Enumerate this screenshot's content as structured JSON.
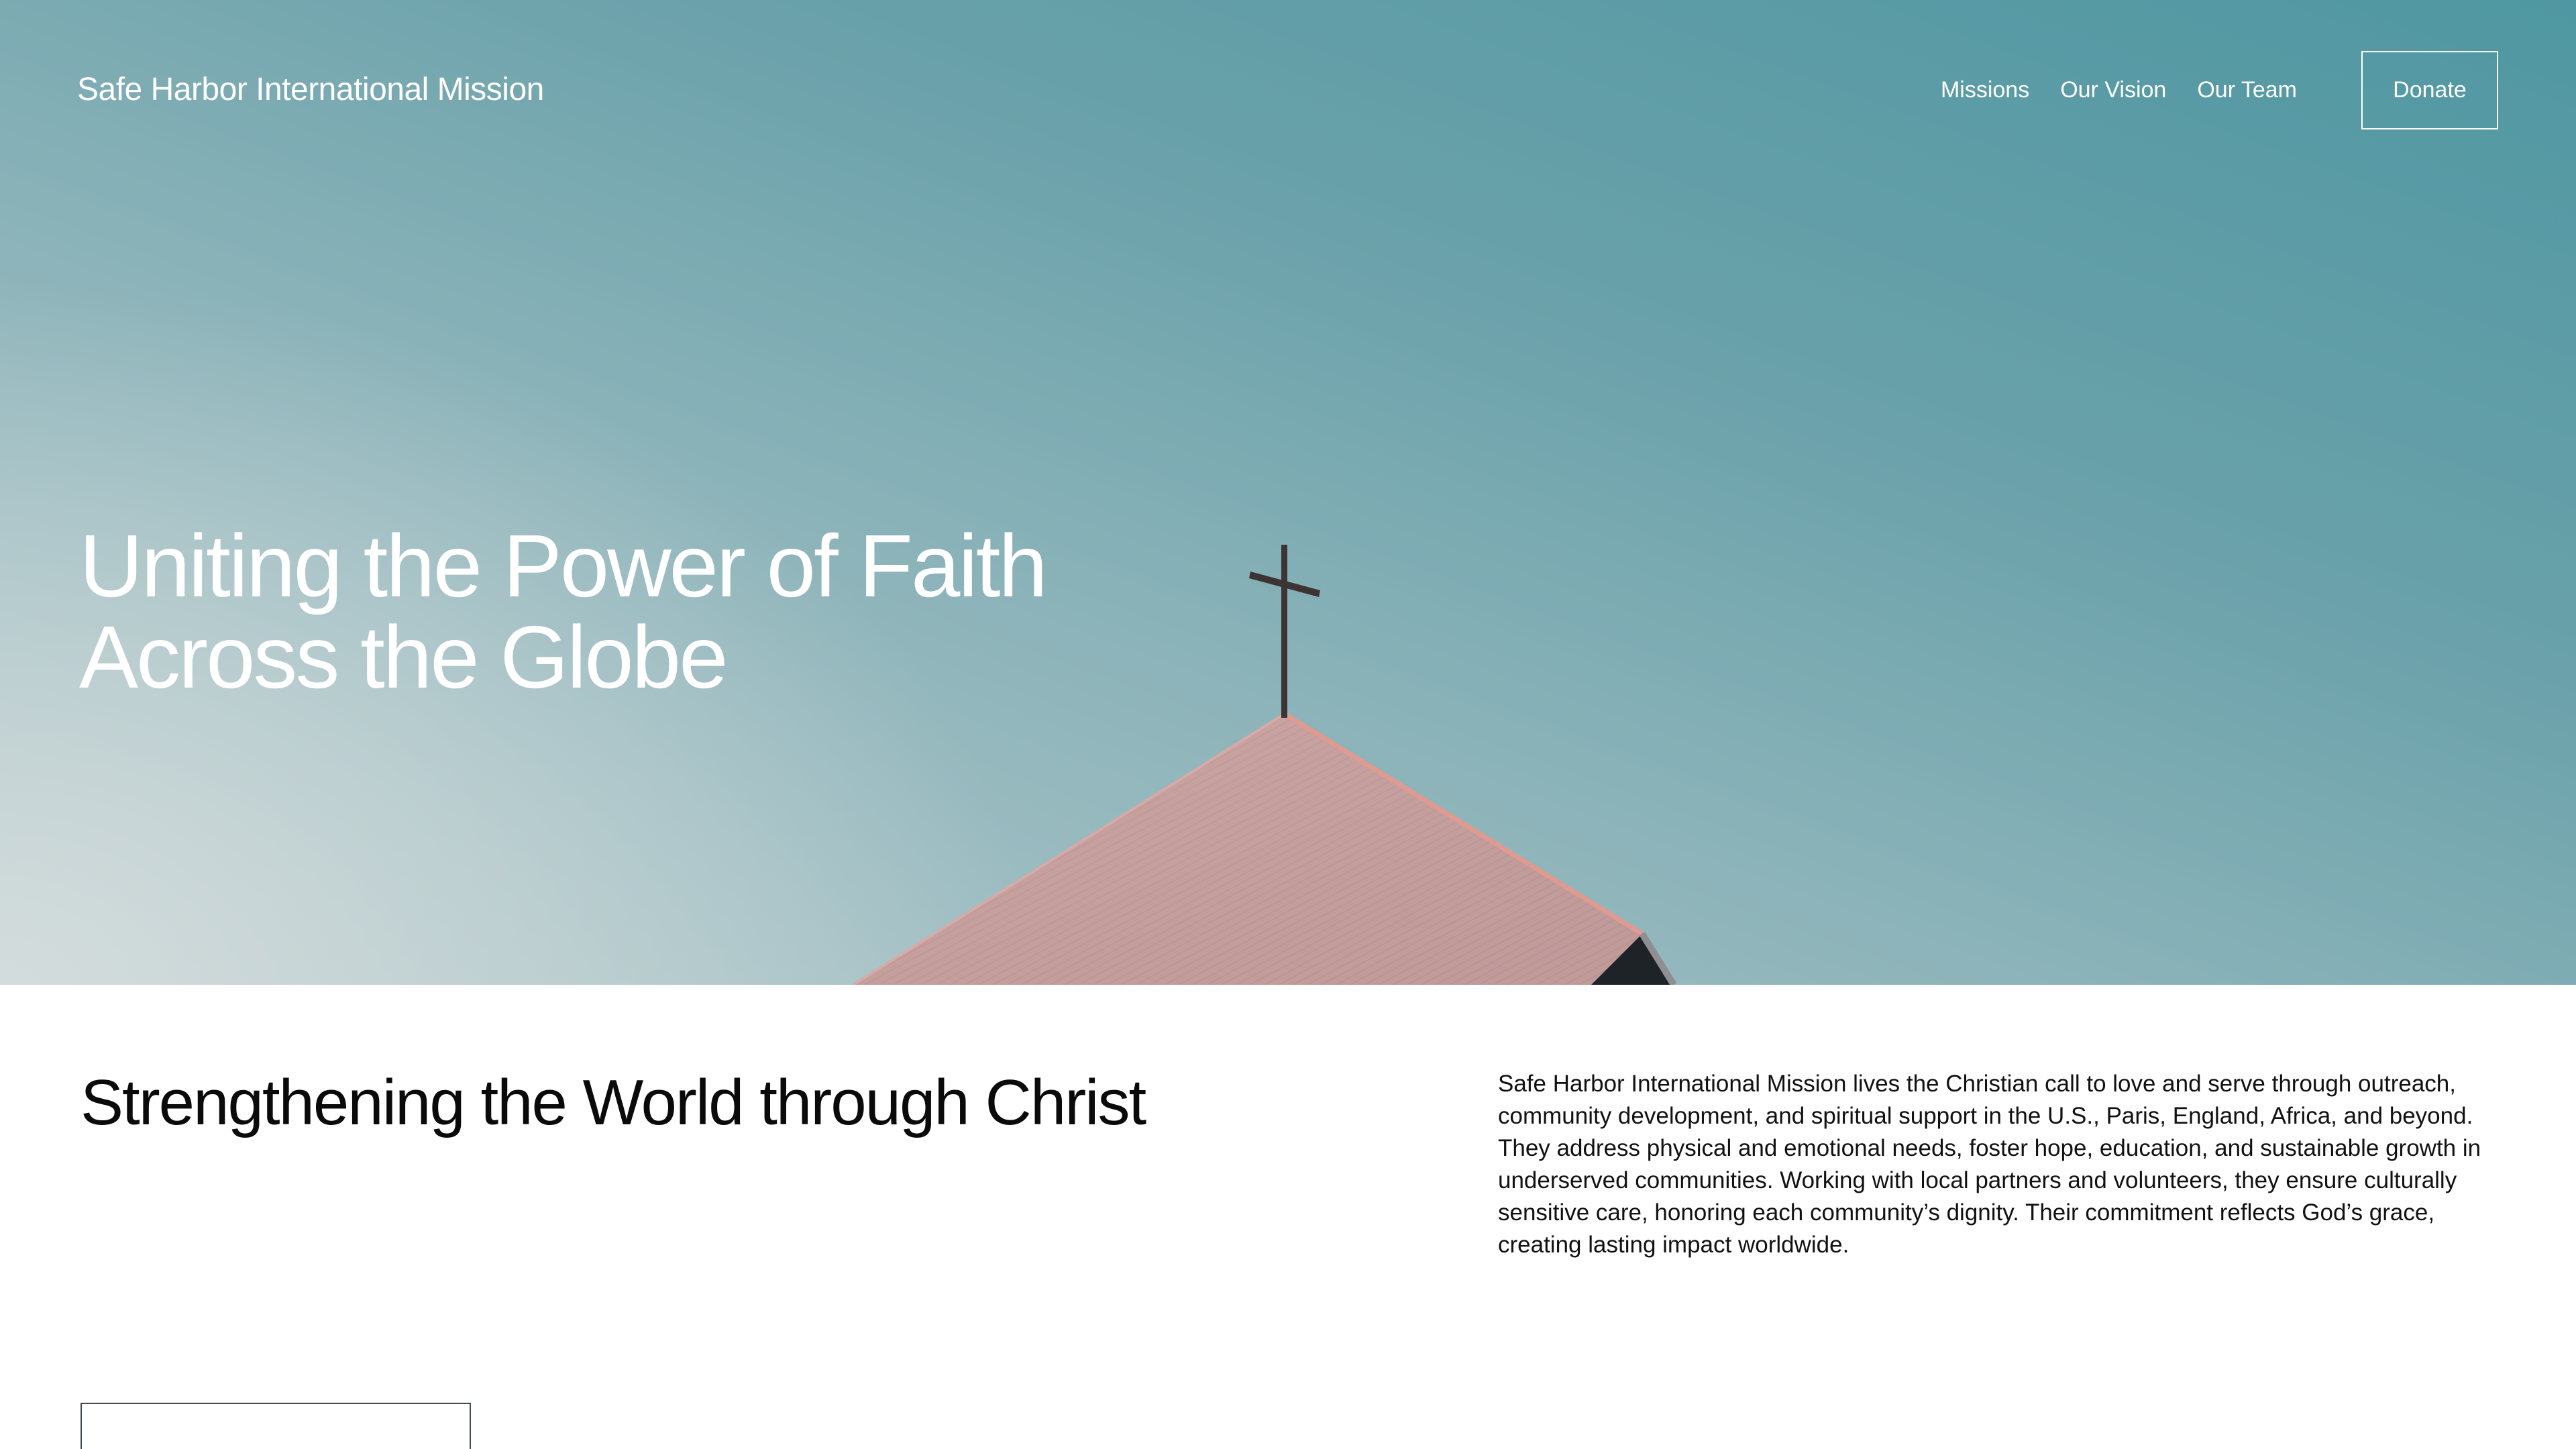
{
  "header": {
    "site_title": "Safe Harbor International Mission",
    "nav": [
      {
        "label": "Missions"
      },
      {
        "label": "Our Vision"
      },
      {
        "label": "Our Team"
      }
    ],
    "donate_label": "Donate"
  },
  "hero": {
    "title_line1": "Uniting the Power of Faith",
    "title_line2": "Across the Globe",
    "image_description_icon": "church-roof-cross-photo"
  },
  "intro": {
    "heading": "Strengthening the World through Christ",
    "body": "Safe Harbor International Mission lives the Christian call to love and serve through outreach, community development, and spiritual support in the U.S., Paris, England, Africa, and beyond. They address physical and emotional needs, foster hope, education, and sustainable growth in underserved communities. Working with local partners and volunteers, they ensure culturally sensitive care, honoring each community’s dignity. Their commitment reflects God’s grace, creating lasting impact worldwide."
  },
  "colors": {
    "sky_top": "#4f97a2",
    "sky_bottom": "#d3dcdc",
    "roof": "#c9a2a0",
    "text_dark": "#0a0a0a"
  }
}
